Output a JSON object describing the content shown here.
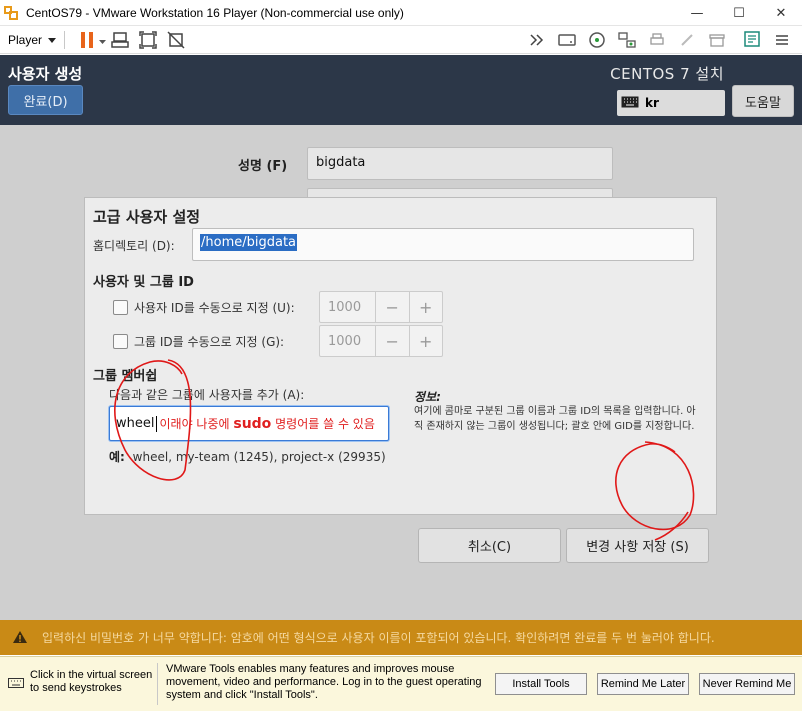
{
  "window": {
    "title": "CentOS79 - VMware Workstation 16 Player (Non-commercial use only)",
    "minimize": "—",
    "maximize": "☐",
    "close": "✕"
  },
  "toolbar": {
    "player_label": "Player",
    "icons": [
      "pause-icon",
      "send-ctrl-alt-del-icon",
      "fit-guest-icon",
      "unity-icon",
      "forward-icon",
      "hdd-icon",
      "cd-icon",
      "network-icon",
      "printer-icon",
      "usb-icon",
      "sound-icon",
      "message-log-icon"
    ]
  },
  "guest": {
    "page_title": "사용자 생성",
    "done_button": "완료(D)",
    "install_title": "CENTOS 7 설치",
    "keyboard_layout": "kr",
    "help_button": "도움말",
    "fullname_label": "성명 (F)",
    "fullname_value": "bigdata"
  },
  "dialog": {
    "title": "고급 사용자 설정",
    "home_label": "홈디렉토리 (D):",
    "home_value": "/home/bigdata",
    "ugid_title": "사용자 및 그룹 ID",
    "uid_check_label": "사용자 ID를 수동으로 지정 (U):",
    "uid_value": "1000",
    "gid_check_label": "그룹 ID를 수동으로 지정 (G):",
    "gid_value": "1000",
    "minus": "−",
    "plus": "+",
    "group_membership_title": "그룹 멤버쉽",
    "group_add_desc": "다음과 같은 그룹에 사용자를 추가 (A):",
    "group_value": "wheel",
    "annotation_prefix": "이래야 나중에 ",
    "annotation_bold": "sudo",
    "annotation_suffix": " 명령어를 쓸 수 있음",
    "example_label": "예:",
    "example_text": "wheel, my-team (1245), project-x (29935)",
    "info_title": "정보:",
    "info_text": "여기에 콤마로 구분된 그룹 이름과 그룹 ID의 목록을 입력합니다. 아직 존재하지 않는 그룹이 생성됩니다; 괄호 안에 GID를 지정합니다.",
    "cancel_button": "취소(C)",
    "save_button": "변경 사항 저장 (S)"
  },
  "warning": {
    "text": "입력하신 비밀번호 가 너무 약합니다: 암호에 어떤 형식으로 사용자 이름이 포함되어 있습니다. 확인하려면 완료를 두 번 눌러야 합니다."
  },
  "tools_bar": {
    "keyboard_hint": "Click in the virtual screen to send keystrokes",
    "message": "VMware Tools enables many features and improves mouse movement, video and performance. Log in to the guest operating system and click \"Install Tools\".",
    "install_button": "Install Tools",
    "remind_later_button": "Remind Me Later",
    "never_remind_button": "Never Remind Me"
  },
  "colors": {
    "header_bg": "#2c3748",
    "done_button": "#3f6fa8",
    "warning_bar": "#c98a16",
    "annotation_red": "#e02020",
    "selection": "#2b6dc4"
  }
}
